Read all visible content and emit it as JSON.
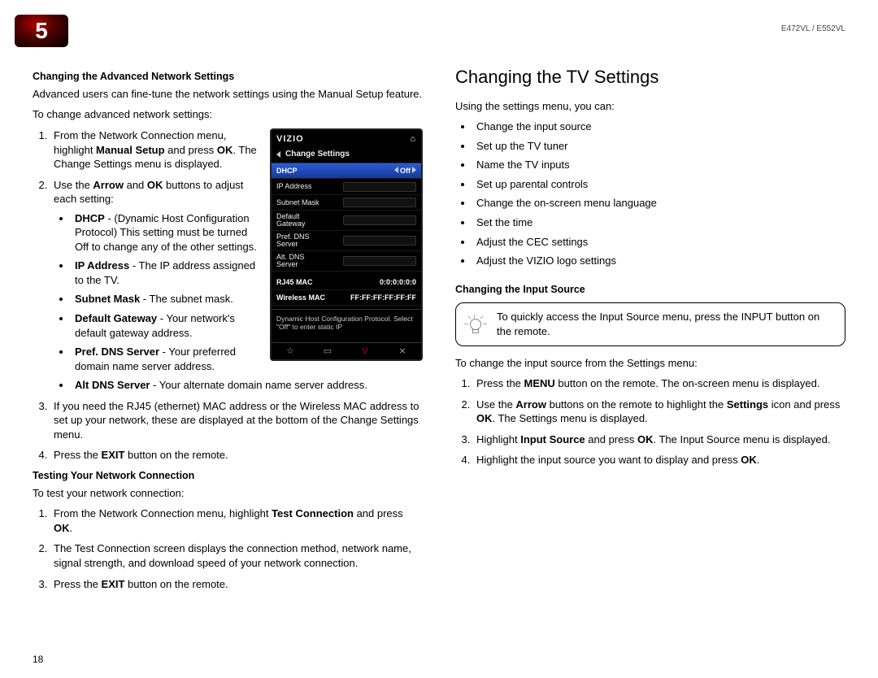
{
  "chapterNumber": "5",
  "modelLabel": "E472VL / E552VL",
  "pageNumber": "18",
  "left": {
    "sec1Title": "Changing the Advanced Network Settings",
    "sec1Intro": "Advanced users can fine-tune the network settings using the Manual Setup feature.",
    "sec1Lead": "To change advanced network settings:",
    "step1_a": "From the Network Connection menu, highlight ",
    "step1_b1": "Manual Setup",
    "step1_c": " and press ",
    "step1_b2": "OK",
    "step1_d": ". The Change Settings menu is displayed.",
    "step2_a": "Use the ",
    "step2_b1": "Arrow",
    "step2_c": " and ",
    "step2_b2": "OK",
    "step2_d": " buttons to adjust each setting:",
    "sub": {
      "dhcp_b": "DHCP",
      "dhcp_t": " - (Dynamic Host Configuration Protocol) This setting must be turned Off to change any of the other settings.",
      "ip_b": "IP Address",
      "ip_t": " - The IP address assigned to the TV.",
      "sm_b": "Subnet Mask",
      "sm_t": " - The subnet mask.",
      "gw_b": "Default Gateway",
      "gw_t": " - Your network's default gateway address.",
      "pdns_b": "Pref. DNS Server",
      "pdns_t": " - Your preferred domain name server address.",
      "adns_b": "Alt DNS Server",
      "adns_t": " - Your alternate domain name server address."
    },
    "step3": "If you need the RJ45 (ethernet) MAC address or the Wireless MAC address to set up your network, these are displayed at the bottom of the Change Settings menu.",
    "step4_a": "Press the ",
    "step4_b": "EXIT",
    "step4_c": " button on the remote.",
    "sec2Title": "Testing Your Network Connection",
    "sec2Lead": "To test your network connection:",
    "t1_a": "From the Network Connection menu, highlight ",
    "t1_b": "Test Connection",
    "t1_c": " and press ",
    "t1_d": "OK",
    "t1_e": ".",
    "t2": "The Test Connection screen displays the connection method, network name, signal strength, and download speed of your network connection.",
    "t3_a": "Press the ",
    "t3_b": "EXIT",
    "t3_c": " button on the remote."
  },
  "tv": {
    "brand": "VIZIO",
    "title": "Change Settings",
    "rows": {
      "dhcp": "DHCP",
      "off": "Off",
      "ip": "IP Address",
      "subnet": "Subnet Mask",
      "gateway": "Default Gateway",
      "pdns": "Pref. DNS Server",
      "adns": "Alt. DNS Server",
      "rj45": "RJ45 MAC",
      "rj45v": "0:0:0:0:0:0",
      "wmac": "Wireless MAC",
      "wmacv": "FF:FF:FF:FF:FF:FF"
    },
    "help": "Dynamic Host Configuration Protocol. Select \"Off\" to enter static IP"
  },
  "right": {
    "h2": "Changing the TV Settings",
    "intro": "Using the settings menu, you can:",
    "bullets": [
      "Change the input source",
      "Set up the TV tuner",
      "Name the TV inputs",
      "Set up parental controls",
      "Change the on-screen menu language",
      "Set the time",
      "Adjust the CEC settings",
      "Adjust the VIZIO logo settings"
    ],
    "inputTitle": "Changing the Input Source",
    "tip": "To quickly access the Input Source menu, press the INPUT button on the remote.",
    "leadIn": "To change the input source from the Settings menu:",
    "s1_a": "Press the ",
    "s1_b": "MENU",
    "s1_c": " button on the remote. The on-screen menu is displayed.",
    "s2_a": "Use the ",
    "s2_b1": "Arrow",
    "s2_c": " buttons on the remote to highlight the ",
    "s2_b2": "Settings",
    "s2_d": " icon and press ",
    "s2_b3": "OK",
    "s2_e": ". The Settings menu is displayed.",
    "s3_a": "Highlight ",
    "s3_b1": "Input Source",
    "s3_c": " and press ",
    "s3_b2": "OK",
    "s3_d": ". The Input Source menu is displayed.",
    "s4_a": "Highlight the input source you want to display and press ",
    "s4_b": "OK",
    "s4_c": "."
  }
}
